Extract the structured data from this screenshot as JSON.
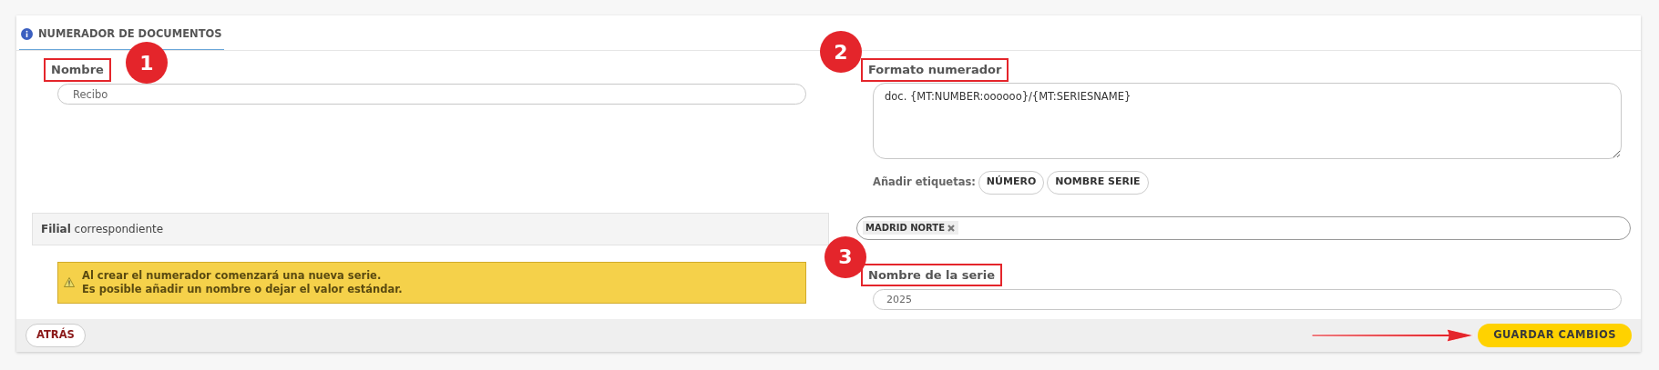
{
  "tab": {
    "label": "NUMERADOR DE DOCUMENTOS",
    "selected": true
  },
  "name_field": {
    "label": "Nombre",
    "value": "Recibo",
    "highlighted": true,
    "badge": "1"
  },
  "format_field": {
    "label": "Formato numerador",
    "value": "doc. {MT:NUMBER:oooooo}/{MT:SERIESNAME}",
    "highlighted": true,
    "badge": "2"
  },
  "tags": {
    "label": "Añadir etiquetas:",
    "buttons": [
      "NÚMERO",
      "NOMBRE SERIE"
    ]
  },
  "branch": {
    "label": "**Filial** correspondiente",
    "chips": [
      "MADRID NORTE"
    ]
  },
  "alert": {
    "lines": [
      "Al crear el numerador comenzará una nueva serie.",
      "Es posible añadir un nombre o dejar el valor estándar."
    ]
  },
  "series_field": {
    "label": "Nombre de la serie",
    "value": "2025",
    "highlighted": true,
    "badge": "3"
  },
  "footer": {
    "back": "ATRÁS",
    "save": "GUARDAR CAMBIOS",
    "save_arrow": true
  }
}
